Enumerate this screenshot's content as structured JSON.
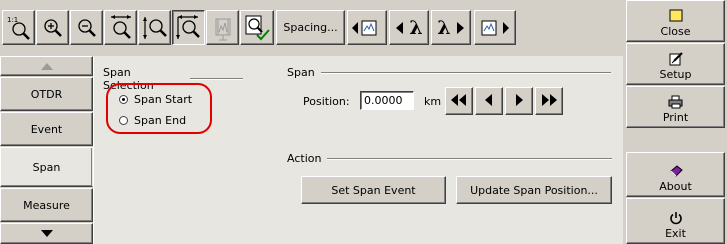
{
  "toolbar": {
    "buttons": [
      {
        "name": "zoom-full-button",
        "icon": "zoom-full-icon"
      },
      {
        "name": "zoom-in-button",
        "icon": "zoom-in-icon"
      },
      {
        "name": "zoom-out-button",
        "icon": "zoom-out-icon"
      },
      {
        "name": "zoom-horizontal-button",
        "icon": "zoom-horizontal-icon"
      },
      {
        "name": "zoom-vertical-button",
        "icon": "zoom-vertical-icon"
      },
      {
        "name": "zoom-area-button",
        "icon": "zoom-area-icon"
      },
      {
        "name": "zoom-marker-button",
        "icon": "zoom-marker-icon"
      },
      {
        "name": "zoom-check-button",
        "icon": "zoom-check-icon"
      }
    ],
    "spacing_label": "Spacing...",
    "lambda_symbol": "λ"
  },
  "right_panel": {
    "close_label": "Close",
    "setup_label": "Setup",
    "print_label": "Print",
    "about_label": "About",
    "exit_label": "Exit"
  },
  "left_nav": {
    "items": [
      {
        "label": "OTDR"
      },
      {
        "label": "Event"
      },
      {
        "label": "Span"
      },
      {
        "label": "Measure"
      }
    ],
    "active": "Span"
  },
  "span_selection": {
    "title": "Span Selection",
    "options": [
      {
        "label": "Span Start",
        "selected": true
      },
      {
        "label": "Span End",
        "selected": false
      }
    ]
  },
  "span": {
    "title": "Span",
    "position_label": "Position:",
    "position_value": "0.0000",
    "unit": "km"
  },
  "action": {
    "title": "Action",
    "set_span_event_label": "Set Span Event",
    "update_span_position_label": "Update Span Position..."
  },
  "colors": {
    "window_bg": "#d4d0c8",
    "highlight_ring": "#e00000",
    "active_nav_bg": "#e8e6e0"
  }
}
